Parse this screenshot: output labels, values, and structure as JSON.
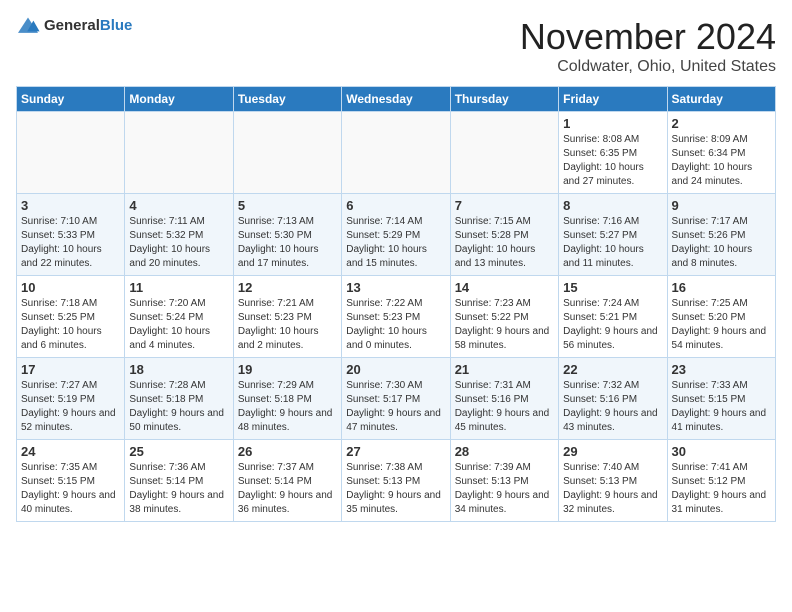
{
  "logo": {
    "general": "General",
    "blue": "Blue"
  },
  "title": "November 2024",
  "location": "Coldwater, Ohio, United States",
  "days_header": [
    "Sunday",
    "Monday",
    "Tuesday",
    "Wednesday",
    "Thursday",
    "Friday",
    "Saturday"
  ],
  "weeks": [
    [
      {
        "day": "",
        "sunrise": "",
        "sunset": "",
        "daylight": ""
      },
      {
        "day": "",
        "sunrise": "",
        "sunset": "",
        "daylight": ""
      },
      {
        "day": "",
        "sunrise": "",
        "sunset": "",
        "daylight": ""
      },
      {
        "day": "",
        "sunrise": "",
        "sunset": "",
        "daylight": ""
      },
      {
        "day": "",
        "sunrise": "",
        "sunset": "",
        "daylight": ""
      },
      {
        "day": "1",
        "sunrise": "Sunrise: 8:08 AM",
        "sunset": "Sunset: 6:35 PM",
        "daylight": "Daylight: 10 hours and 27 minutes."
      },
      {
        "day": "2",
        "sunrise": "Sunrise: 8:09 AM",
        "sunset": "Sunset: 6:34 PM",
        "daylight": "Daylight: 10 hours and 24 minutes."
      }
    ],
    [
      {
        "day": "3",
        "sunrise": "Sunrise: 7:10 AM",
        "sunset": "Sunset: 5:33 PM",
        "daylight": "Daylight: 10 hours and 22 minutes."
      },
      {
        "day": "4",
        "sunrise": "Sunrise: 7:11 AM",
        "sunset": "Sunset: 5:32 PM",
        "daylight": "Daylight: 10 hours and 20 minutes."
      },
      {
        "day": "5",
        "sunrise": "Sunrise: 7:13 AM",
        "sunset": "Sunset: 5:30 PM",
        "daylight": "Daylight: 10 hours and 17 minutes."
      },
      {
        "day": "6",
        "sunrise": "Sunrise: 7:14 AM",
        "sunset": "Sunset: 5:29 PM",
        "daylight": "Daylight: 10 hours and 15 minutes."
      },
      {
        "day": "7",
        "sunrise": "Sunrise: 7:15 AM",
        "sunset": "Sunset: 5:28 PM",
        "daylight": "Daylight: 10 hours and 13 minutes."
      },
      {
        "day": "8",
        "sunrise": "Sunrise: 7:16 AM",
        "sunset": "Sunset: 5:27 PM",
        "daylight": "Daylight: 10 hours and 11 minutes."
      },
      {
        "day": "9",
        "sunrise": "Sunrise: 7:17 AM",
        "sunset": "Sunset: 5:26 PM",
        "daylight": "Daylight: 10 hours and 8 minutes."
      }
    ],
    [
      {
        "day": "10",
        "sunrise": "Sunrise: 7:18 AM",
        "sunset": "Sunset: 5:25 PM",
        "daylight": "Daylight: 10 hours and 6 minutes."
      },
      {
        "day": "11",
        "sunrise": "Sunrise: 7:20 AM",
        "sunset": "Sunset: 5:24 PM",
        "daylight": "Daylight: 10 hours and 4 minutes."
      },
      {
        "day": "12",
        "sunrise": "Sunrise: 7:21 AM",
        "sunset": "Sunset: 5:23 PM",
        "daylight": "Daylight: 10 hours and 2 minutes."
      },
      {
        "day": "13",
        "sunrise": "Sunrise: 7:22 AM",
        "sunset": "Sunset: 5:23 PM",
        "daylight": "Daylight: 10 hours and 0 minutes."
      },
      {
        "day": "14",
        "sunrise": "Sunrise: 7:23 AM",
        "sunset": "Sunset: 5:22 PM",
        "daylight": "Daylight: 9 hours and 58 minutes."
      },
      {
        "day": "15",
        "sunrise": "Sunrise: 7:24 AM",
        "sunset": "Sunset: 5:21 PM",
        "daylight": "Daylight: 9 hours and 56 minutes."
      },
      {
        "day": "16",
        "sunrise": "Sunrise: 7:25 AM",
        "sunset": "Sunset: 5:20 PM",
        "daylight": "Daylight: 9 hours and 54 minutes."
      }
    ],
    [
      {
        "day": "17",
        "sunrise": "Sunrise: 7:27 AM",
        "sunset": "Sunset: 5:19 PM",
        "daylight": "Daylight: 9 hours and 52 minutes."
      },
      {
        "day": "18",
        "sunrise": "Sunrise: 7:28 AM",
        "sunset": "Sunset: 5:18 PM",
        "daylight": "Daylight: 9 hours and 50 minutes."
      },
      {
        "day": "19",
        "sunrise": "Sunrise: 7:29 AM",
        "sunset": "Sunset: 5:18 PM",
        "daylight": "Daylight: 9 hours and 48 minutes."
      },
      {
        "day": "20",
        "sunrise": "Sunrise: 7:30 AM",
        "sunset": "Sunset: 5:17 PM",
        "daylight": "Daylight: 9 hours and 47 minutes."
      },
      {
        "day": "21",
        "sunrise": "Sunrise: 7:31 AM",
        "sunset": "Sunset: 5:16 PM",
        "daylight": "Daylight: 9 hours and 45 minutes."
      },
      {
        "day": "22",
        "sunrise": "Sunrise: 7:32 AM",
        "sunset": "Sunset: 5:16 PM",
        "daylight": "Daylight: 9 hours and 43 minutes."
      },
      {
        "day": "23",
        "sunrise": "Sunrise: 7:33 AM",
        "sunset": "Sunset: 5:15 PM",
        "daylight": "Daylight: 9 hours and 41 minutes."
      }
    ],
    [
      {
        "day": "24",
        "sunrise": "Sunrise: 7:35 AM",
        "sunset": "Sunset: 5:15 PM",
        "daylight": "Daylight: 9 hours and 40 minutes."
      },
      {
        "day": "25",
        "sunrise": "Sunrise: 7:36 AM",
        "sunset": "Sunset: 5:14 PM",
        "daylight": "Daylight: 9 hours and 38 minutes."
      },
      {
        "day": "26",
        "sunrise": "Sunrise: 7:37 AM",
        "sunset": "Sunset: 5:14 PM",
        "daylight": "Daylight: 9 hours and 36 minutes."
      },
      {
        "day": "27",
        "sunrise": "Sunrise: 7:38 AM",
        "sunset": "Sunset: 5:13 PM",
        "daylight": "Daylight: 9 hours and 35 minutes."
      },
      {
        "day": "28",
        "sunrise": "Sunrise: 7:39 AM",
        "sunset": "Sunset: 5:13 PM",
        "daylight": "Daylight: 9 hours and 34 minutes."
      },
      {
        "day": "29",
        "sunrise": "Sunrise: 7:40 AM",
        "sunset": "Sunset: 5:13 PM",
        "daylight": "Daylight: 9 hours and 32 minutes."
      },
      {
        "day": "30",
        "sunrise": "Sunrise: 7:41 AM",
        "sunset": "Sunset: 5:12 PM",
        "daylight": "Daylight: 9 hours and 31 minutes."
      }
    ]
  ]
}
